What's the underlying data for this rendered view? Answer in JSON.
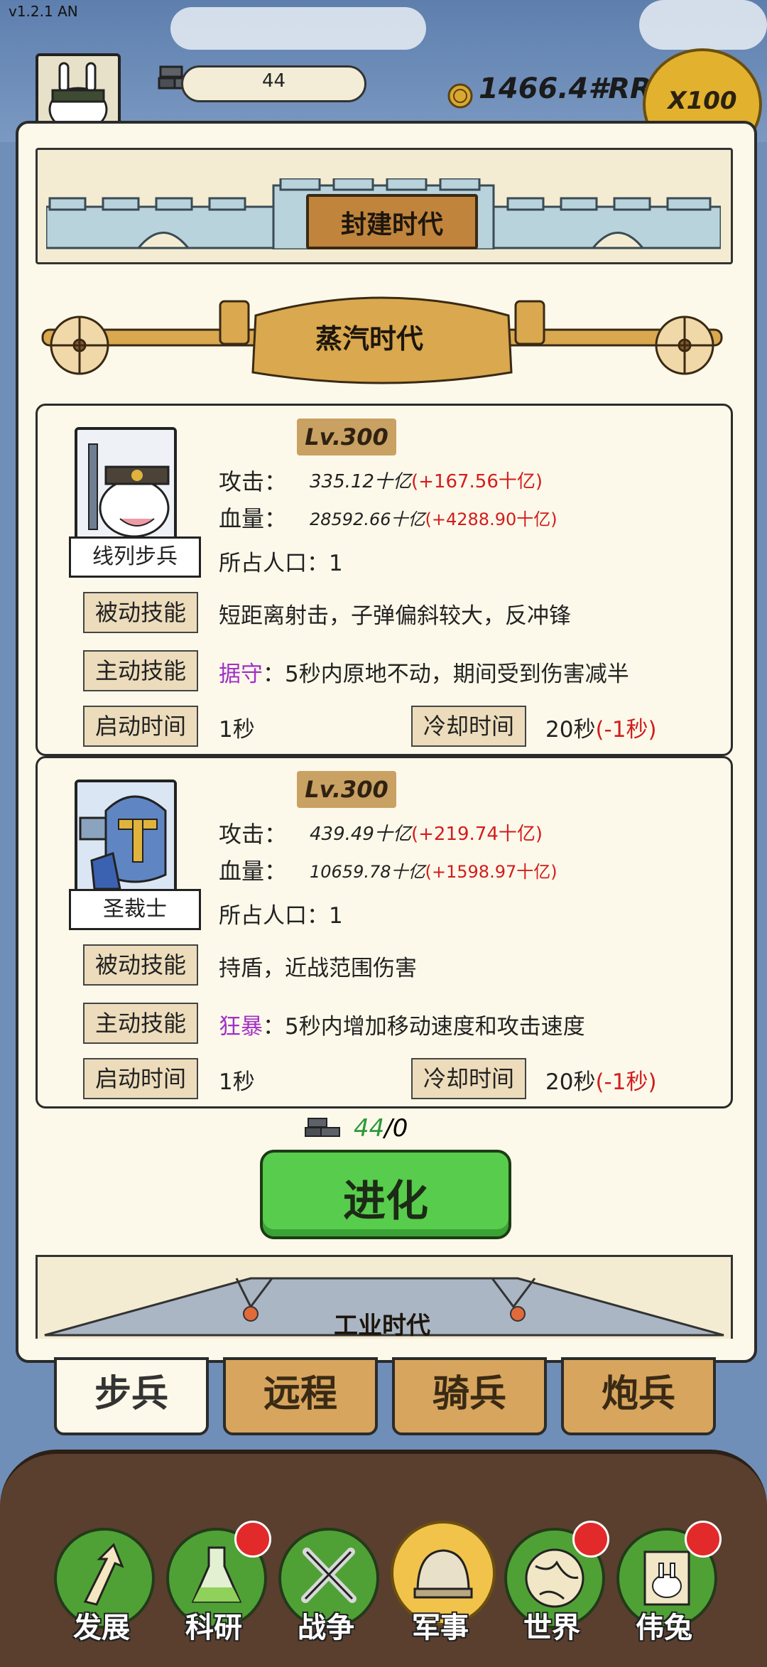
{
  "version": "v1.2.1 AN",
  "topbar": {
    "resource_value": "44",
    "gold_value": "1466.4#RR",
    "multiplier_label": "X100"
  },
  "eras": {
    "feudal": "封建时代",
    "steam": "蒸汽时代",
    "industrial": "工业时代"
  },
  "units": [
    {
      "name": "线列步兵",
      "level": "Lv.300",
      "attack_label": "攻击：",
      "attack_value": "335.12十亿",
      "attack_bonus": "(+167.56十亿)",
      "hp_label": "血量：",
      "hp_value": "28592.66十亿",
      "hp_bonus": "(+4288.90十亿)",
      "population": "所占人口：1",
      "passive_label": "被动技能",
      "passive_text": "短距离射击，子弹偏斜较大，反冲锋",
      "active_label": "主动技能",
      "active_name": "据守",
      "active_text": "：5秒内原地不动，期间受到伤害减半",
      "start_label": "启动时间",
      "start_value": "1秒",
      "cooldown_label": "冷却时间",
      "cooldown_value": "20秒",
      "cooldown_bonus": "(-1秒)"
    },
    {
      "name": "圣裁士",
      "level": "Lv.300",
      "attack_label": "攻击：",
      "attack_value": "439.49十亿",
      "attack_bonus": "(+219.74十亿)",
      "hp_label": "血量：",
      "hp_value": "10659.78十亿",
      "hp_bonus": "(+1598.97十亿)",
      "population": "所占人口：1",
      "passive_label": "被动技能",
      "passive_text": "持盾，近战范围伤害",
      "active_label": "主动技能",
      "active_name": "狂暴",
      "active_text": "：5秒内增加移动速度和攻击速度",
      "start_label": "启动时间",
      "start_value": "1秒",
      "cooldown_label": "冷却时间",
      "cooldown_value": "20秒",
      "cooldown_bonus": "(-1秒)"
    }
  ],
  "evolve": {
    "cost_have": "44",
    "cost_need": "/0",
    "button_label": "进化"
  },
  "categories": [
    "步兵",
    "远程",
    "骑兵",
    "炮兵"
  ],
  "nav": [
    "发展",
    "科研",
    "战争",
    "军事",
    "世界",
    "伟兔"
  ],
  "colors": {
    "bonus_red": "#d21d1d",
    "skill_purple": "#a030c8",
    "evolve_green": "#58cc4c",
    "cost_green": "#2d9a3a"
  }
}
